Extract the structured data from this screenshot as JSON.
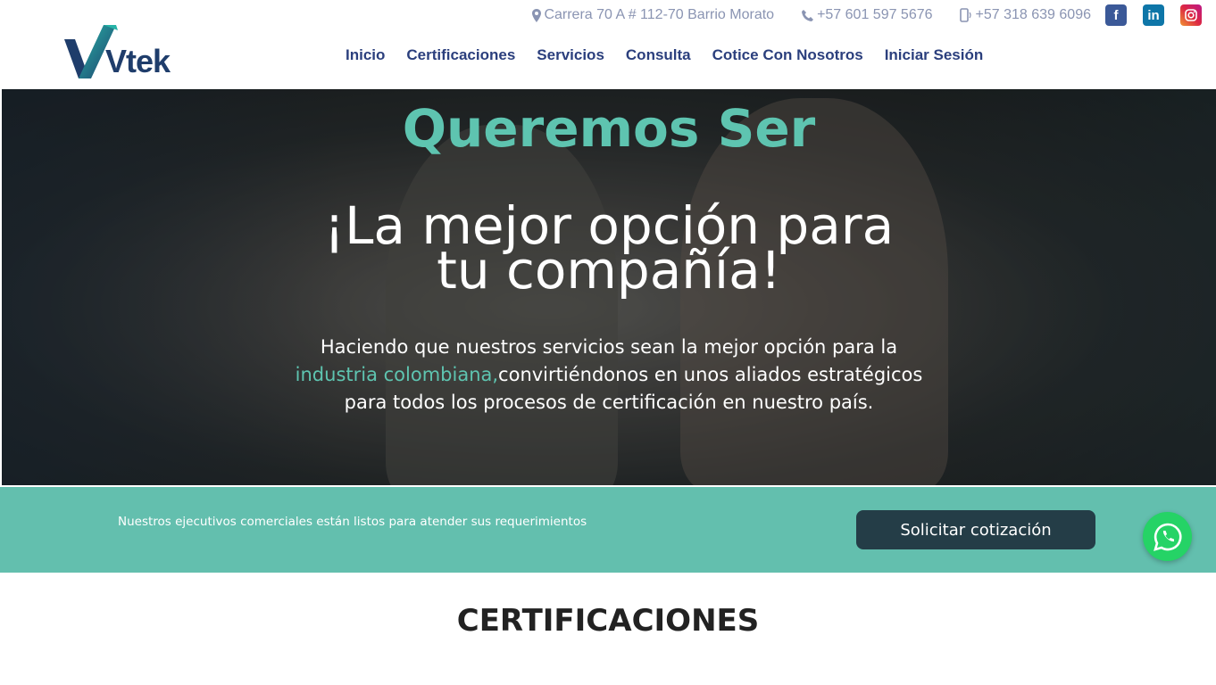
{
  "brand": {
    "name": "Vtek"
  },
  "topbar": {
    "address": "Carrera 70 A # 112-70 Barrio Morato",
    "phone": "+57 601 597 5676",
    "mobile": "+57 318 639 6096"
  },
  "nav": {
    "items": [
      "Inicio",
      "Certificaciones",
      "Servicios",
      "Consulta",
      "Cotice Con Nosotros",
      "Iniciar Sesión"
    ]
  },
  "hero": {
    "kicker": "Queremos Ser",
    "title": "¡La mejor opción para tu compañía!",
    "text_before": "Haciendo que nuestros servicios sean la mejor opción para la ",
    "text_highlight": "industria colombiana,",
    "text_after": "convirtiéndonos en unos aliados estratégicos para todos los procesos de certificación en nuestro país."
  },
  "cta": {
    "text": "Nuestros ejecutivos comerciales están listos para atender sus requerimientos",
    "button_label": "Solicitar cotización"
  },
  "section": {
    "title": "CERTIFICACIONES"
  },
  "colors": {
    "accent": "#5ec4b0",
    "nav": "#2b3f7d",
    "cta_bg": "#63bfae",
    "cta_button": "#243d47"
  },
  "icons": [
    "map-marker-icon",
    "phone-icon",
    "mobile-icon",
    "facebook-icon",
    "linkedin-icon",
    "instagram-icon",
    "whatsapp-icon"
  ]
}
